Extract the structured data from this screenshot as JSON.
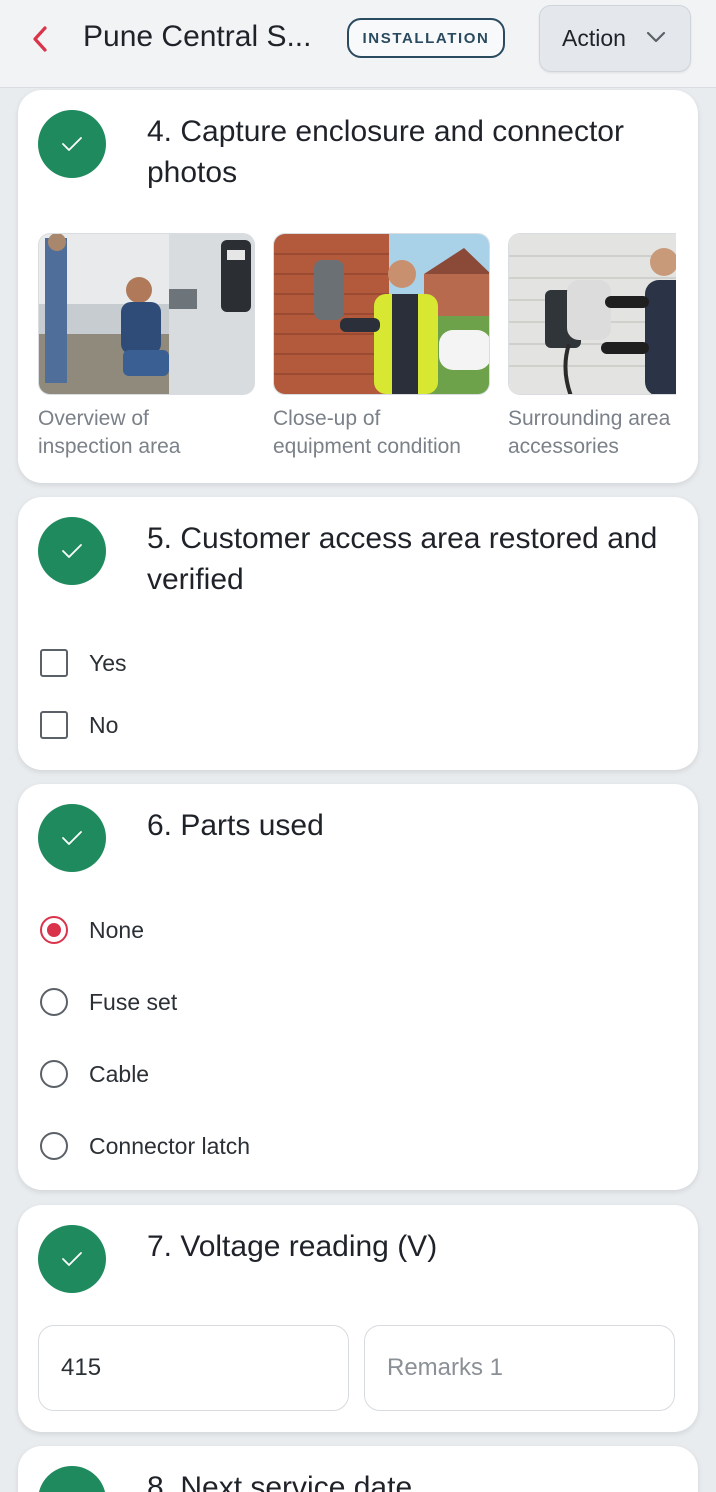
{
  "header": {
    "title": "Pune Central S...",
    "badge": "INSTALLATION",
    "action_label": "Action"
  },
  "questions": {
    "q4": {
      "title": "4. Capture enclosure and connector photos",
      "photos": [
        {
          "caption_line1": "Overview of",
          "caption_line2": "inspection area"
        },
        {
          "caption_line1": "Close-up of",
          "caption_line2": "equipment condition"
        },
        {
          "caption_line1": "Surrounding area",
          "caption_line2": "accessories"
        }
      ]
    },
    "q5": {
      "title": "5. Customer access area restored and verified",
      "options": [
        "Yes",
        "No"
      ]
    },
    "q6": {
      "title": "6. Parts used",
      "options": [
        "None",
        "Fuse set",
        "Cable",
        "Connector latch"
      ],
      "selected": "None"
    },
    "q7": {
      "title": "7. Voltage reading (V)",
      "value": "415",
      "remarks_placeholder": "Remarks 1"
    },
    "q8": {
      "title": "8. Next service date"
    }
  },
  "colors": {
    "accent_red": "#d9344a",
    "check_green": "#1f8a5e",
    "badge_border": "#2a4a5f"
  }
}
